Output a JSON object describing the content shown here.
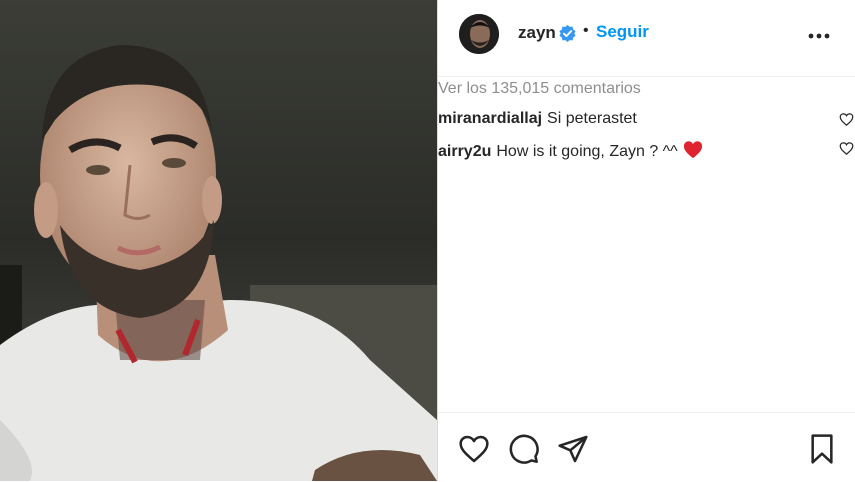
{
  "post": {
    "username": "zayn",
    "separator": "•",
    "follow_label": "Seguir",
    "verified": true,
    "view_all_comments": "Ver los 135,015 comentarios"
  },
  "comments": [
    {
      "user": "miranardiallaj",
      "text": "Si peterastet"
    },
    {
      "user": "airry2u",
      "text": "How is it going, Zayn ? ^^",
      "emoji": "red-heart"
    }
  ],
  "icons": {
    "verified": "verified-badge-icon",
    "more": "more-options-icon",
    "like": "heart-icon",
    "comment": "comment-icon",
    "share": "paper-plane-icon",
    "save": "bookmark-icon"
  },
  "colors": {
    "accent": "#0095f6",
    "text": "#262626",
    "muted": "#8e8e8e",
    "heart": "#ed4956"
  }
}
